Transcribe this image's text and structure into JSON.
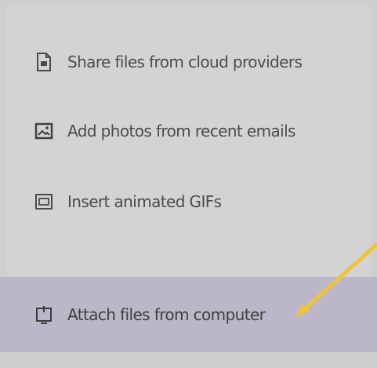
{
  "menu": {
    "items": [
      {
        "label": "Share files from cloud providers",
        "icon": "cloud-file-icon"
      },
      {
        "label": "Add photos from recent emails",
        "icon": "photo-icon"
      },
      {
        "label": "Insert animated GIFs",
        "icon": "gif-icon"
      },
      {
        "label": "Attach files from computer",
        "icon": "computer-upload-icon"
      }
    ]
  },
  "colors": {
    "menu_bg": "#d3d3d3",
    "highlight_bg": "#bcb6c9",
    "text": "#4c4c4c",
    "annotation": "#f0c43a"
  }
}
